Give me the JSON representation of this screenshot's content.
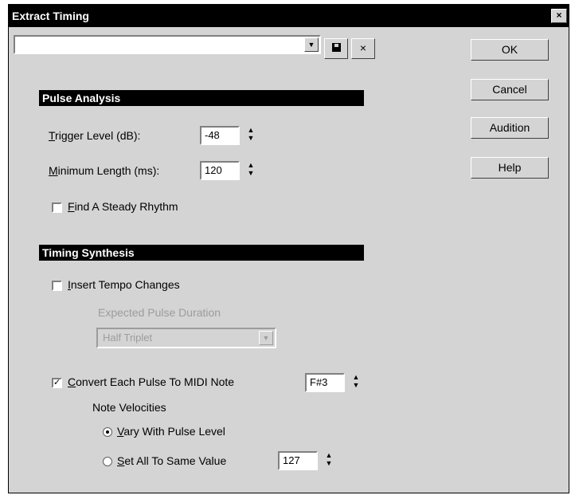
{
  "window": {
    "title": "Extract Timing",
    "close_glyph": "×"
  },
  "preset": {
    "value": "",
    "arrow": "▼",
    "delete_glyph": "×"
  },
  "buttons": {
    "ok": "OK",
    "cancel": "Cancel",
    "audition": "Audition",
    "help": "Help"
  },
  "pulse_analysis": {
    "header": "Pulse Analysis",
    "trigger_level": {
      "label_u": "T",
      "label_rest": "rigger Level (dB):",
      "value": "-48"
    },
    "minimum_length": {
      "label_u": "M",
      "label_rest": "inimum Length (ms):",
      "value": "120"
    },
    "steady_rhythm": {
      "label_u": "F",
      "label_rest": "ind A Steady Rhythm",
      "checked": false
    }
  },
  "timing_synthesis": {
    "header": "Timing Synthesis",
    "insert_tempo": {
      "label_u": "I",
      "label_rest": "nsert Tempo Changes",
      "checked": false
    },
    "expected_pulse_label": "Expected Pulse Duration",
    "expected_pulse_value": "Half Triplet",
    "convert_pulse": {
      "label_u": "C",
      "label_rest": "onvert Each Pulse To MIDI Note",
      "checked": true,
      "check_glyph": "✓",
      "note": "F#3"
    },
    "velocities_label": "Note Velocities",
    "vary": {
      "label_u": "V",
      "label_rest": "ary With Pulse Level",
      "selected": true
    },
    "set_all": {
      "label_u": "S",
      "label_rest": "et All To Same Value",
      "selected": false,
      "value": "127"
    }
  },
  "spinner": {
    "up": "▲",
    "down": "▼"
  }
}
